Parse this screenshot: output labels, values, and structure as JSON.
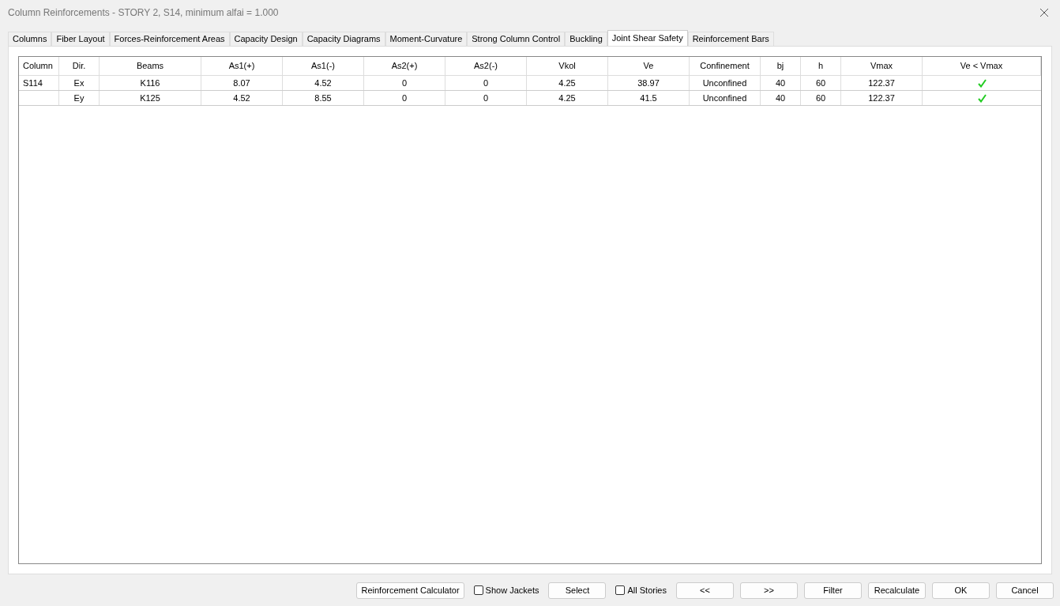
{
  "window": {
    "title": "Column Reinforcements - STORY 2, S14, minimum alfai = 1.000"
  },
  "tabs": [
    {
      "label": "Columns",
      "selected": false
    },
    {
      "label": "Fiber Layout",
      "selected": false
    },
    {
      "label": "Forces-Reinforcement Areas",
      "selected": false
    },
    {
      "label": "Capacity Design",
      "selected": false
    },
    {
      "label": "Capacity Diagrams",
      "selected": false
    },
    {
      "label": "Moment-Curvature",
      "selected": false
    },
    {
      "label": "Strong Column Control",
      "selected": false
    },
    {
      "label": "Buckling",
      "selected": false
    },
    {
      "label": "Joint Shear Safety",
      "selected": true
    },
    {
      "label": "Reinforcement Bars",
      "selected": false
    }
  ],
  "table": {
    "columns": [
      "Column",
      "Dir.",
      "Beams",
      "As1(+)",
      "As1(-)",
      "As2(+)",
      "As2(-)",
      "Vkol",
      "Ve",
      "Confinement",
      "bj",
      "h",
      "Vmax",
      "Ve < Vmax"
    ],
    "rows": [
      {
        "cells": [
          "S114",
          "Ex",
          "K116",
          "8.07",
          "4.52",
          "0",
          "0",
          "4.25",
          "38.97",
          "Unconfined",
          "40",
          "60",
          "122.37"
        ],
        "pass": true
      },
      {
        "cells": [
          "",
          "Ey",
          "K125",
          "4.52",
          "8.55",
          "0",
          "0",
          "4.25",
          "41.5",
          "Unconfined",
          "40",
          "60",
          "122.37"
        ],
        "pass": true
      }
    ]
  },
  "footer": [
    {
      "kind": "button",
      "label": "Reinforcement Calculator"
    },
    {
      "kind": "checkbox",
      "label": "Show Jackets",
      "checked": false
    },
    {
      "kind": "button",
      "label": "Select"
    },
    {
      "kind": "checkbox",
      "label": "All Stories",
      "checked": false
    },
    {
      "kind": "button",
      "label": "<<"
    },
    {
      "kind": "button",
      "label": ">>"
    },
    {
      "kind": "button",
      "label": "Filter"
    },
    {
      "kind": "button",
      "label": "Recalculate"
    },
    {
      "kind": "button",
      "label": "OK"
    },
    {
      "kind": "button",
      "label": "Cancel"
    }
  ]
}
